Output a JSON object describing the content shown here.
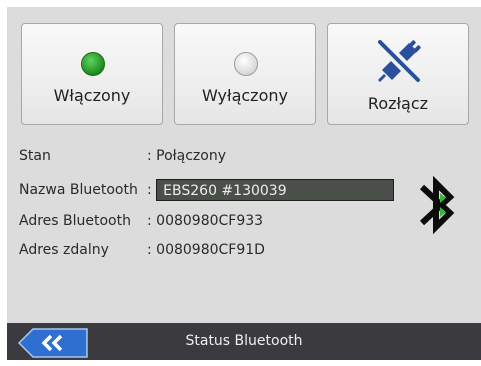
{
  "buttons": {
    "on_label": "Włączony",
    "off_label": "Wyłączony",
    "disconnect_label": "Rozłącz"
  },
  "info": {
    "status_label": "Stan",
    "status_value": ": Połączony",
    "name_label": "Nazwa Bluetooth",
    "name_colon": ":",
    "name_value": "EBS260 #130039",
    "address_label": "Adres Bluetooth",
    "address_value": ": 0080980CF933",
    "remote_label": "Adres zdalny",
    "remote_value": ": 0080980CF91D"
  },
  "footer": {
    "title": "Status Bluetooth",
    "back_icon": "double-chevron-left-icon"
  },
  "colors": {
    "led_on": "#2fa02f",
    "footer_bg": "#3a3a3f",
    "back_button": "#2f6fd0",
    "name_field_bg": "#4a4f4a"
  }
}
